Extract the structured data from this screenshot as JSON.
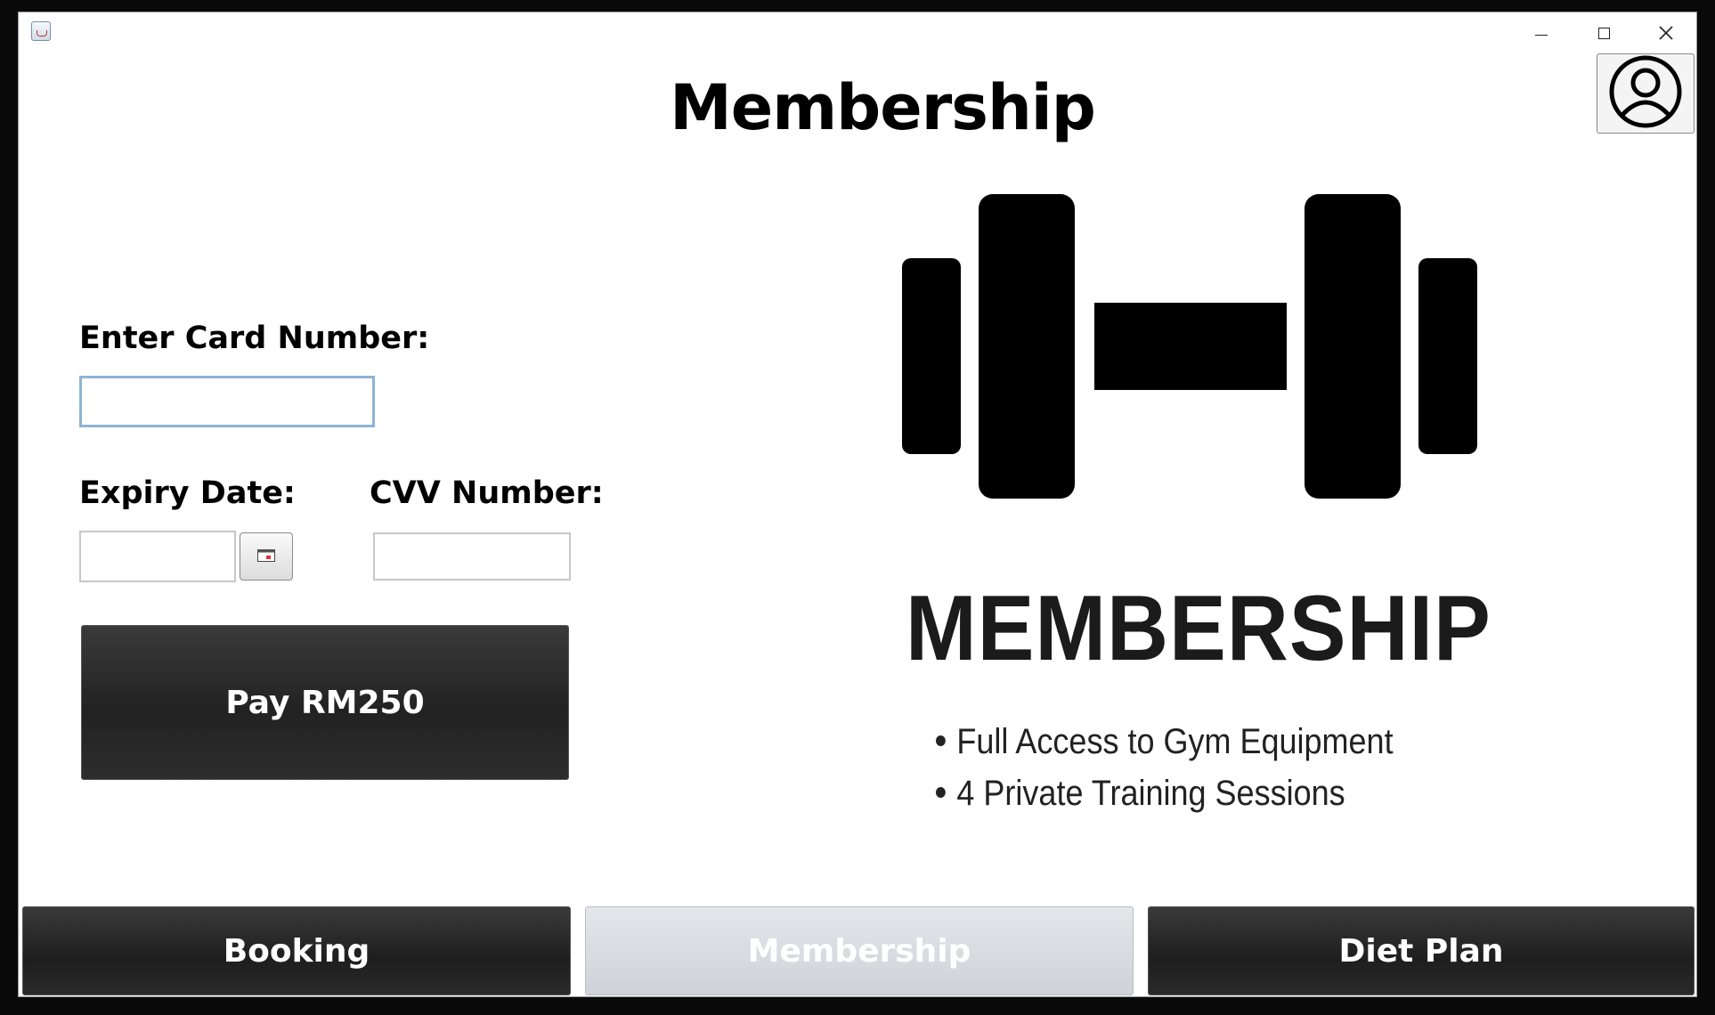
{
  "window": {
    "title": "",
    "controls": [
      "minimize-icon",
      "maximize-icon",
      "close-icon"
    ]
  },
  "header": {
    "title": "Membership",
    "profile_icon": "user-profile-icon"
  },
  "form": {
    "card_label": "Enter Card Number:",
    "card_value": "",
    "expiry_label": "Expiry Date:",
    "expiry_value": "",
    "calendar_icon": "calendar-icon",
    "cvv_label": "CVV Number:",
    "cvv_value": "",
    "pay_label": "Pay RM250"
  },
  "promo": {
    "icon": "dumbbell-icon",
    "heading": "MEMBERSHIP",
    "benefits": [
      "Full Access to Gym Equipment",
      "4 Private Training Sessions"
    ]
  },
  "nav": {
    "tabs": [
      {
        "label": "Booking",
        "active": false
      },
      {
        "label": "Membership",
        "active": true
      },
      {
        "label": "Diet Plan",
        "active": false
      }
    ]
  },
  "colors": {
    "button_dark": "#222222",
    "tab_active_bg": "#d8dadf",
    "input_focus_border": "#8eb3d4"
  }
}
